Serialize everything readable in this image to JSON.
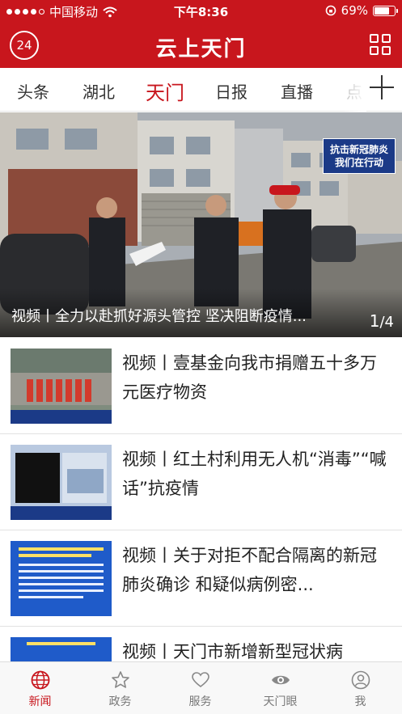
{
  "status_bar": {
    "carrier": "中国移动",
    "time": "下午8:36",
    "battery": "69%"
  },
  "header": {
    "badge": "24",
    "title": "云上天门"
  },
  "tabs": [
    {
      "label": "头条"
    },
    {
      "label": "湖北"
    },
    {
      "label": "天门",
      "active": true
    },
    {
      "label": "日报"
    },
    {
      "label": "直播"
    },
    {
      "label": "点"
    }
  ],
  "hero": {
    "caption": "视频丨全力以赴抓好源头管控 坚决阻断疫情...",
    "overlay_tag_line1": "抗击新冠肺炎",
    "overlay_tag_line2": "我们在行动",
    "index_current": "1",
    "index_total": "4"
  },
  "news": [
    {
      "title": "视频丨壹基金向我市捐赠五十多万元医疗物资"
    },
    {
      "title": "视频丨红土村利用无人机“消毒”“喊话”抗疫情"
    },
    {
      "title": "视频丨关于对拒不配合隔离的新冠肺炎确诊 和疑似病例密..."
    },
    {
      "title": "视频丨天门市新增新型冠状病"
    }
  ],
  "bottom_nav": [
    {
      "label": "新闻",
      "icon": "globe-icon",
      "active": true
    },
    {
      "label": "政务",
      "icon": "star-icon"
    },
    {
      "label": "服务",
      "icon": "heart-icon"
    },
    {
      "label": "天门眼",
      "icon": "eye-icon"
    },
    {
      "label": "我",
      "icon": "user-icon"
    }
  ],
  "colors": {
    "brand_red": "#c8161d",
    "tag_blue": "#1b3a87"
  }
}
